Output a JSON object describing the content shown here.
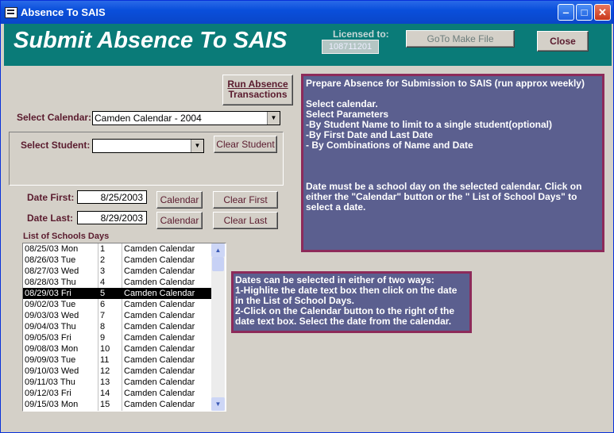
{
  "window": {
    "title": "Absence To SAIS"
  },
  "header": {
    "title": "Submit Absence To SAIS",
    "licensed_label": "Licensed to:",
    "licensed_value": "108711201",
    "goto_button": "GoTo Make File",
    "close_button": "Close"
  },
  "buttons": {
    "run_line1": "Run Absence",
    "run_line2": "Transactions",
    "clear_student": "Clear Student",
    "calendar": "Calendar",
    "clear_first": "Clear First",
    "clear_last": "Clear Last"
  },
  "form": {
    "select_calendar_label": "Select Calendar:",
    "calendar_value": "Camden Calendar - 2004",
    "select_student_label": "Select Student:",
    "student_value": "",
    "date_first_label": "Date First:",
    "date_first_value": "8/25/2003",
    "date_last_label": "Date Last:",
    "date_last_value": "8/29/2003",
    "list_label": "List of Schools Days"
  },
  "info1": {
    "lines": [
      "Prepare Absence for Submission to SAIS (run approx weekly)",
      "",
      "Select calendar.",
      "Select  Parameters",
      "-By Student Name to limit to a single student(optional)",
      "-By First Date  and  Last Date",
      "- By Combinations of Name and Date",
      "",
      "",
      "",
      "Date must be a school day on the selected calendar. Click on",
      "either the \"Calendar\" button or the \" List of School Days\" to",
      "select a date."
    ]
  },
  "info2": {
    "lines": [
      "Dates can be selected in either of two ways:",
      "1-Highlite the date text box then click on the date",
      "in the List of School Days.",
      "2-Click on the Calendar button to the right of the",
      "date text box. Select the date from the calendar."
    ]
  },
  "school_days": [
    {
      "date": "08/25/03 Mon",
      "num": "1",
      "cal": "Camden Calendar"
    },
    {
      "date": "08/26/03 Tue",
      "num": "2",
      "cal": "Camden Calendar"
    },
    {
      "date": "08/27/03 Wed",
      "num": "3",
      "cal": "Camden Calendar"
    },
    {
      "date": "08/28/03 Thu",
      "num": "4",
      "cal": "Camden Calendar"
    },
    {
      "date": "08/29/03 Fri",
      "num": "5",
      "cal": "Camden Calendar",
      "selected": true
    },
    {
      "date": "09/02/03 Tue",
      "num": "6",
      "cal": "Camden Calendar"
    },
    {
      "date": "09/03/03 Wed",
      "num": "7",
      "cal": "Camden Calendar"
    },
    {
      "date": "09/04/03 Thu",
      "num": "8",
      "cal": "Camden Calendar"
    },
    {
      "date": "09/05/03 Fri",
      "num": "9",
      "cal": "Camden Calendar"
    },
    {
      "date": "09/08/03 Mon",
      "num": "10",
      "cal": "Camden Calendar"
    },
    {
      "date": "09/09/03 Tue",
      "num": "11",
      "cal": "Camden Calendar"
    },
    {
      "date": "09/10/03 Wed",
      "num": "12",
      "cal": "Camden Calendar"
    },
    {
      "date": "09/11/03 Thu",
      "num": "13",
      "cal": "Camden Calendar"
    },
    {
      "date": "09/12/03 Fri",
      "num": "14",
      "cal": "Camden Calendar"
    },
    {
      "date": "09/15/03 Mon",
      "num": "15",
      "cal": "Camden Calendar"
    }
  ]
}
